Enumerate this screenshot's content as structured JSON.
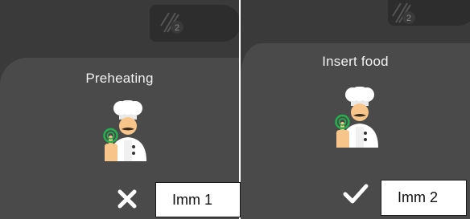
{
  "screens": [
    {
      "title": "Preheating",
      "action": "close-icon"
    },
    {
      "title": "Insert food",
      "action": "check-icon"
    }
  ],
  "tab_badge": "2",
  "labels": [
    "Imm 1",
    "Imm 2"
  ],
  "colors": {
    "background": "#3a3a3a",
    "panel": "#4a4a4a",
    "text": "#f2f2f2",
    "touch_ring": "#22b14c"
  }
}
